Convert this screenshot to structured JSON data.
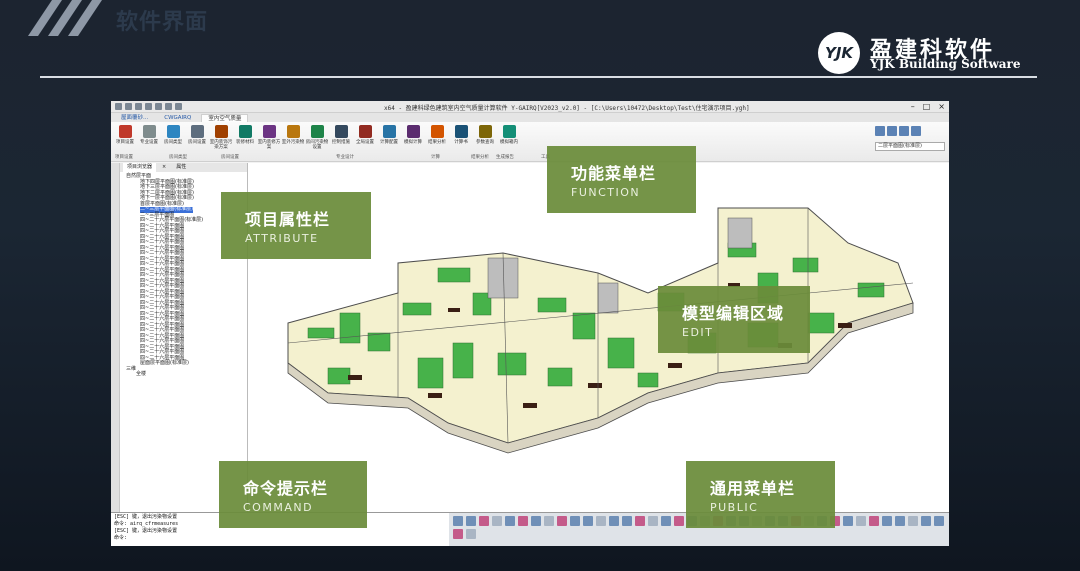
{
  "slide": {
    "title": "软件界面"
  },
  "logo": {
    "mark": "YJK",
    "cn": "盈建科软件",
    "en": "YJK Building Software"
  },
  "app": {
    "title": "x64 - 盈建科绿色建筑室内空气质量计算软件 Y-GAIRQ[V2023_v2.0] - [C:\\Users\\10472\\Desktop\\Test\\住宅演示项目.ygh]",
    "tabs": [
      "屋面覆砂...",
      "CWGAIRQ",
      "室内空气质量"
    ],
    "ribbon_buttons": [
      "项目设置",
      "专业设置",
      "房间类型",
      "房间设置",
      "室内装饰污染方案",
      "装修材料",
      "室内装修方案",
      "室外污染物",
      "房间污染物设置",
      "控制措施",
      "全局设置",
      "计算配置",
      "模拟计算",
      "结果分析",
      "计算书",
      "参数查询",
      "模拟箱内"
    ],
    "ribbon_groups": [
      "项目设置",
      "房间类型",
      "房间设置",
      "专业设计",
      "计算",
      "结果分析",
      "生成报告",
      "工具"
    ],
    "floor_select": "二层平面图(标准层)",
    "panel_tabs": [
      "项目浏览器",
      "×",
      "属性"
    ],
    "tree": {
      "root": "自然层平面",
      "items": [
        "地下四层平面图(标准层)",
        "地下三层平面图(标准层)",
        "地下二层平面图(标准层)",
        "地下一层平面图(标准层)",
        "首层平面图(标准层)",
        "二~三层平面图(标准层)",
        "二~三层平面图",
        "四~二十六层平面图(标准层)",
        "四~二十六层平面图",
        "四~二十六层平面图",
        "四~二十六层平面图",
        "四~二十六层平面图",
        "四~二十六层平面图",
        "四~二十六层平面图",
        "四~二十六层平面图",
        "四~二十六层平面图",
        "四~二十六层平面图",
        "四~二十六层平面图",
        "四~二十六层平面图",
        "四~二十六层平面图",
        "四~二十六层平面图",
        "四~二十六层平面图",
        "四~二十六层平面图",
        "四~二十六层平面图",
        "四~二十六层平面图",
        "四~二十六层平面图",
        "四~二十六层平面图",
        "四~二十六层平面图",
        "四~二十六层平面图",
        "四~二十六层平面图",
        "四~二十六层平面图",
        "四~二十六层平面图",
        "四~二十六层平面图",
        "屋面层平面图(标准层)"
      ],
      "selected_index": 5,
      "root2": "三维",
      "root2_child": "全楼"
    },
    "command_lines": [
      "[ESC] 键，退出污染物设置",
      "命令: airq_cfrmeasures",
      "[ESC] 键，退出污染物设置",
      "命令:"
    ]
  },
  "callouts": {
    "attribute": {
      "cn": "项目属性栏",
      "en": "ATTRIBUTE"
    },
    "function": {
      "cn": "功能菜单栏",
      "en": "FUNCTION"
    },
    "edit": {
      "cn": "模型编辑区域",
      "en": "EDIT"
    },
    "command": {
      "cn": "命令提示栏",
      "en": "COMMAND"
    },
    "public": {
      "cn": "通用菜单栏",
      "en": "PUBLIC"
    }
  },
  "colors": {
    "callout_green": "#6a8c3a",
    "room_green": "#47b24a",
    "background": "#1b2633"
  }
}
